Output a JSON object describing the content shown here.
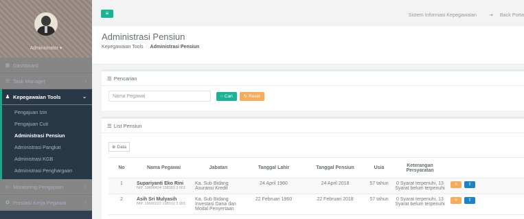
{
  "profile": {
    "name": "Administrator"
  },
  "nav": {
    "dashboard": "Dashboard",
    "task_manager": "Task Manager",
    "kepegawaian": "Kepegawaian Tools",
    "sub": [
      "Pengajuan Izin",
      "Pengajuan Cuti",
      "Administrasi Pensiun",
      "Administrasi Pangkat",
      "Administrasi KGB",
      "Administrasi Penghargaan"
    ],
    "monitoring": "Monitoring Pengajuan",
    "prestasi": "Prestasi Kerja Pegawai"
  },
  "topbar": {
    "system": "Sistem Informasi Kepegawaian",
    "back": "Back Porta"
  },
  "heading": {
    "title": "Administrasi Pensiun",
    "crumb1": "Kepegawaian Tools",
    "crumb2": "Administrasi Pensiun"
  },
  "search": {
    "title": "Pencarian",
    "placeholder": "Nama Pegawai",
    "cari": "Cari",
    "reset": "Reset"
  },
  "list": {
    "title": "List Pensiun",
    "data_button": "Data",
    "headers": [
      "No",
      "Nama Pegawai",
      "Jabatan",
      "Tanggal Lahir",
      "Tanggal Pensiun",
      "Usia",
      "Keterangan Persyaratan"
    ],
    "rows": [
      {
        "no": "1",
        "name": "Supariyanti Eko Rini",
        "nip": "NIP. 19600424 198303 2 001",
        "jabatan": "Ka. Sub Bidang Asuransi Kredit",
        "lahir": "24 April 1960",
        "pensiun": "24 April 2018",
        "usia": "57 tahun",
        "ket": "0 Syarat terpenuhi, 13 Syarat belum terpenuhi"
      },
      {
        "no": "2",
        "name": "Asih Sri Mulyasih",
        "nip": "NIP. 19600222 198012 2 001",
        "jabatan": "Ka. Sub Bidang Investasi Dana dan Modal Penyertaan",
        "lahir": "22 Februari 1960",
        "pensiun": "22 Februari 2018",
        "usia": "57 tahun",
        "ket": "0 Syarat terpenuhi, 13 Syarat belum terpenuhi"
      }
    ]
  }
}
